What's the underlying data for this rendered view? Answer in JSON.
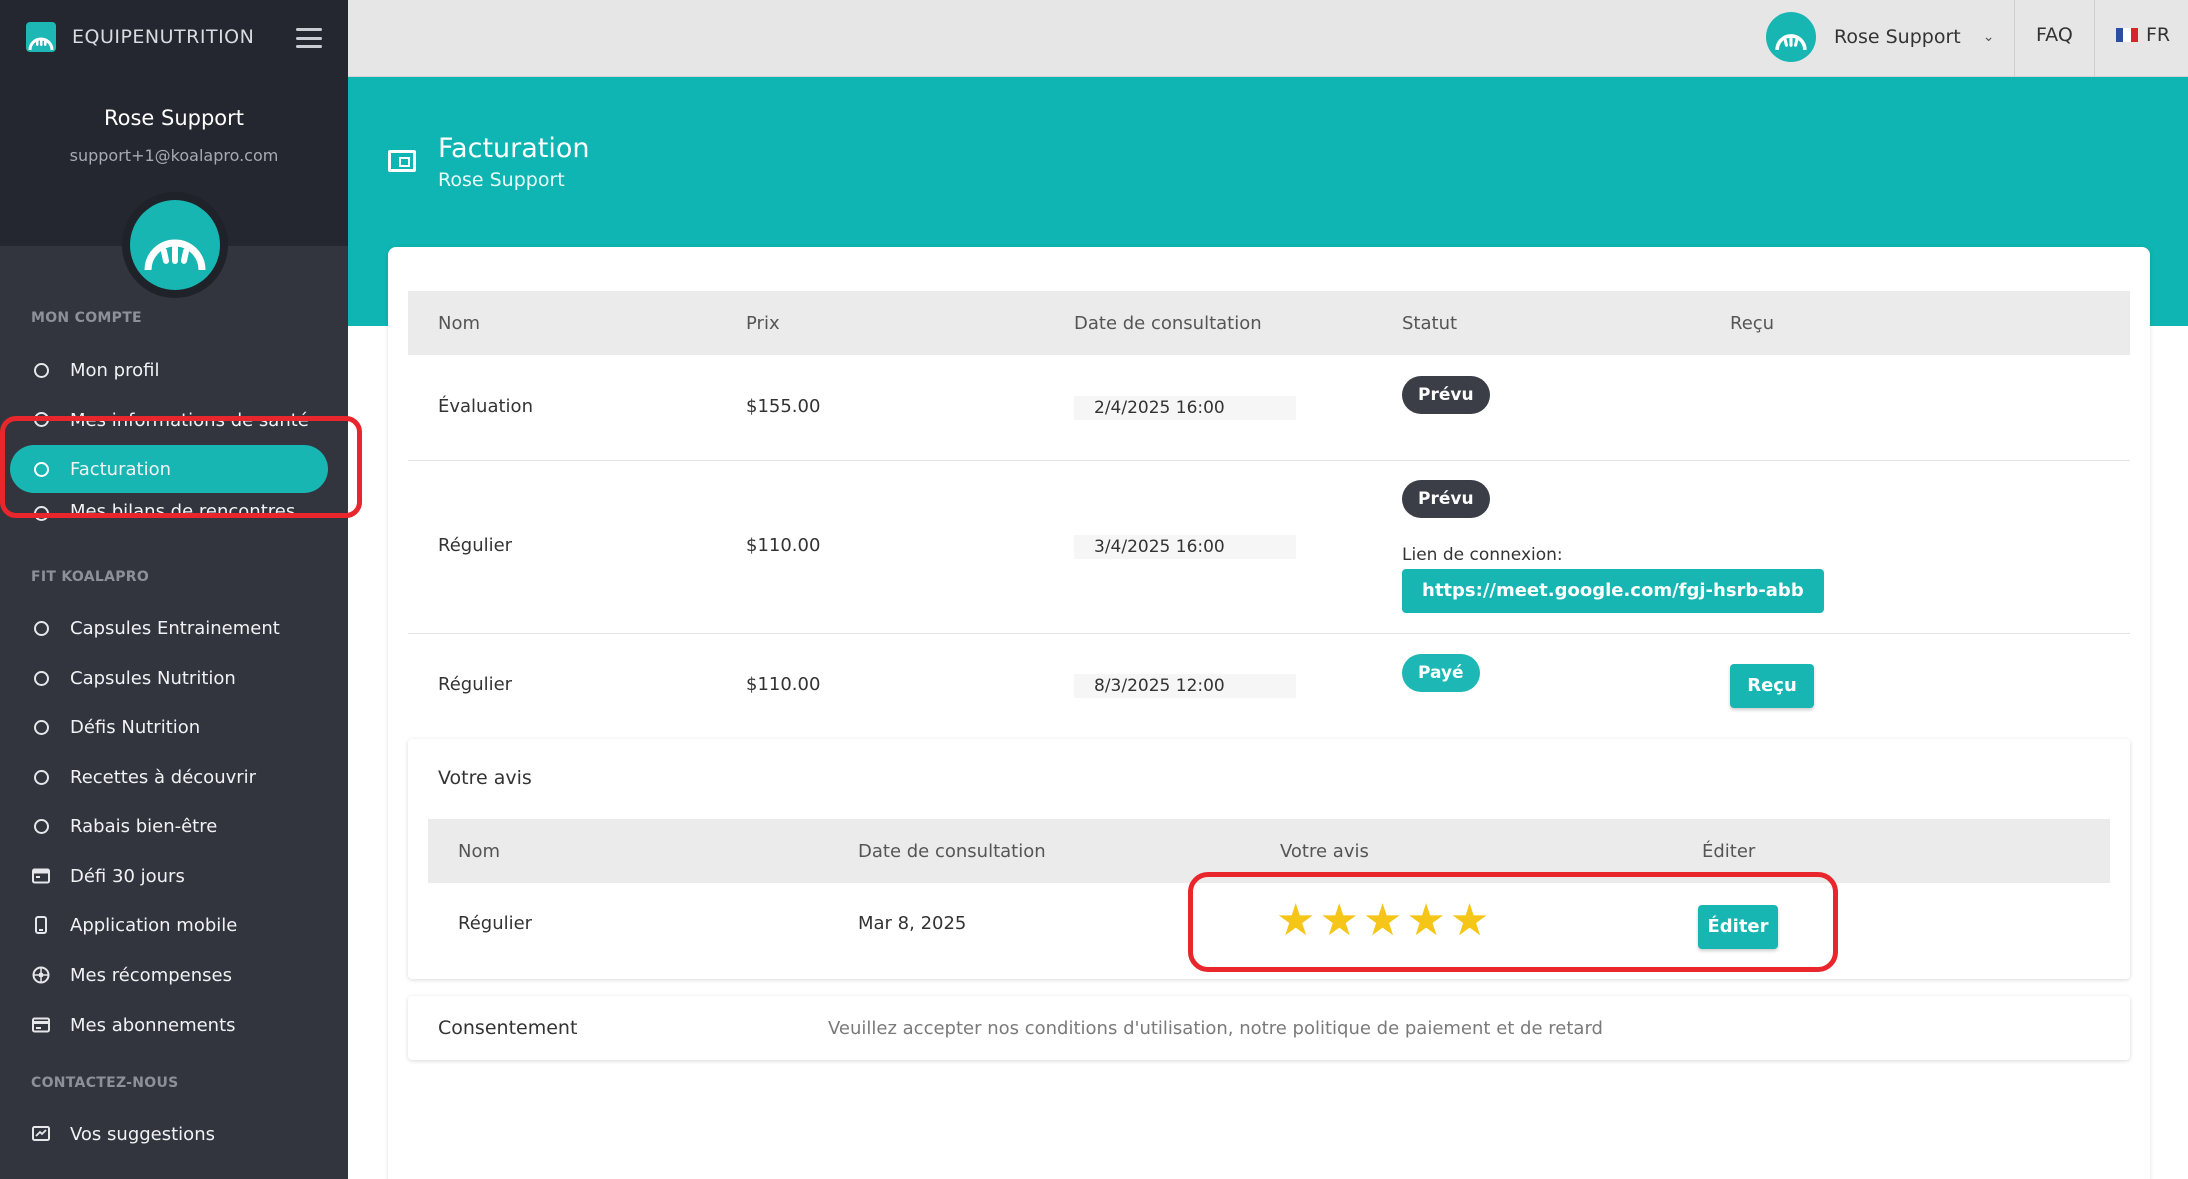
{
  "brand": {
    "name": "EQUIPENUTRITION"
  },
  "user": {
    "name": "Rose Support",
    "email": "support+1@koalapro.com"
  },
  "sidebar": {
    "sections": [
      {
        "title": "MON COMPTE"
      },
      {
        "title": "FIT KOALAPRO"
      },
      {
        "title": "CONTACTEZ-NOUS"
      }
    ],
    "items": [
      {
        "label": "Mon profil",
        "icon": "circle-icon"
      },
      {
        "label": "Mes informations de santé",
        "icon": "circle-icon"
      },
      {
        "label": "Facturation",
        "icon": "circle-icon",
        "active": true
      },
      {
        "label": "Mes bilans de rencontres",
        "icon": "circle-icon"
      },
      {
        "label": "Capsules Entrainement",
        "icon": "circle-icon"
      },
      {
        "label": "Capsules Nutrition",
        "icon": "circle-icon"
      },
      {
        "label": "Défis Nutrition",
        "icon": "circle-icon"
      },
      {
        "label": "Recettes à découvrir",
        "icon": "circle-icon"
      },
      {
        "label": "Rabais bien-être",
        "icon": "circle-icon"
      },
      {
        "label": "Défi 30 jours",
        "icon": "calendar-icon"
      },
      {
        "label": "Application mobile",
        "icon": "mobile-icon"
      },
      {
        "label": "Mes récompenses",
        "icon": "award-icon"
      },
      {
        "label": "Mes abonnements",
        "icon": "card-icon"
      },
      {
        "label": "Vos suggestions",
        "icon": "feedback-icon"
      }
    ]
  },
  "topbar": {
    "user_name": "Rose Support",
    "faq": "FAQ",
    "lang": "FR"
  },
  "header": {
    "title": "Facturation",
    "subtitle": "Rose Support"
  },
  "billing": {
    "columns": [
      "Nom",
      "Prix",
      "Date de consultation",
      "Statut",
      "Reçu"
    ],
    "rows": [
      {
        "name": "Évaluation",
        "price": "$155.00",
        "date": "2/4/2025 16:00",
        "status": "Prévu"
      },
      {
        "name": "Régulier",
        "price": "$110.00",
        "date": "3/4/2025 16:00",
        "status": "Prévu",
        "link_label": "Lien de connexion:",
        "link": "https://meet.google.com/fgj-hsrb-abb"
      },
      {
        "name": "Régulier",
        "price": "$110.00",
        "date": "8/3/2025 12:00",
        "status": "Payé",
        "receipt": "Reçu"
      }
    ]
  },
  "review": {
    "title": "Votre avis",
    "columns": [
      "Nom",
      "Date de consultation",
      "Votre avis",
      "Éditer"
    ],
    "rows": [
      {
        "name": "Régulier",
        "date": "Mar 8, 2025",
        "rating": 5,
        "rating_max": 5,
        "edit": "Éditer"
      }
    ]
  },
  "consent": {
    "label": "Consentement",
    "text": "Veuillez accepter nos conditions d'utilisation, notre politique de paiement et de retard"
  },
  "colors": {
    "accent": "#17b6b3",
    "sidebar": "#32353e",
    "highlight": "#e8262c",
    "star": "#f5c518"
  }
}
